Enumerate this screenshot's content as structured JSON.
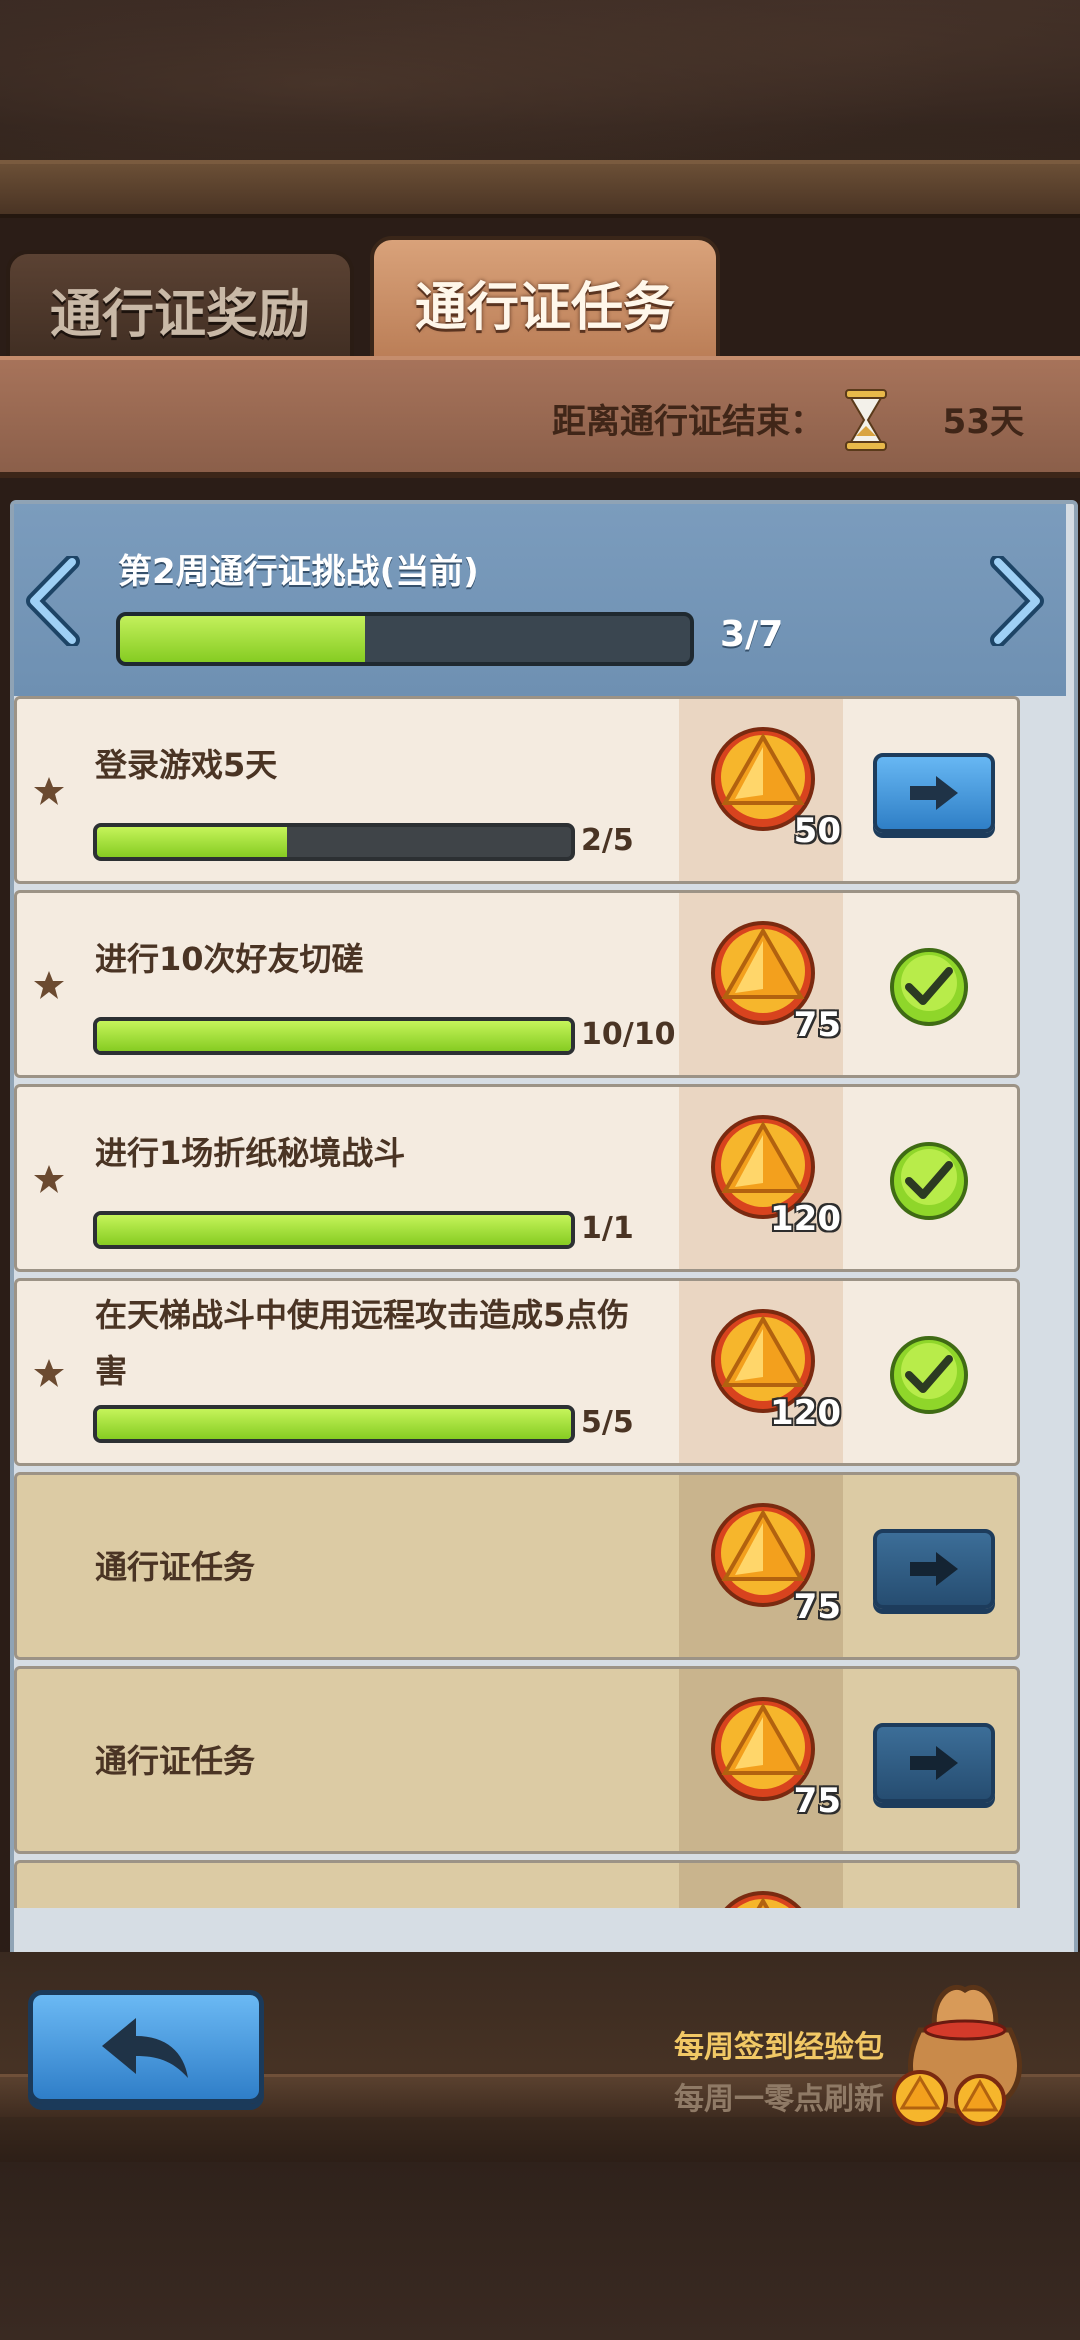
{
  "tabs": [
    {
      "label": "通行证奖励",
      "active": false
    },
    {
      "label": "通行证任务",
      "active": true
    }
  ],
  "countdown": {
    "label": "距离通行证结束：",
    "value": "53天"
  },
  "week": {
    "title": "第2周通行证挑战(当前)",
    "progress_text": "3/7",
    "progress": 0.43
  },
  "tasks": [
    {
      "name": "登录游戏5天",
      "progress_text": "2/5",
      "progress": 0.4,
      "reward": "50",
      "state": "go"
    },
    {
      "name": "进行10次好友切磋",
      "progress_text": "10/10",
      "progress": 1.0,
      "reward": "75",
      "state": "done"
    },
    {
      "name": "进行1场折纸秘境战斗",
      "progress_text": "1/1",
      "progress": 1.0,
      "reward": "120",
      "state": "done"
    },
    {
      "name": "在天梯战斗中使用远程攻击造成5点伤害",
      "progress_text": "5/5",
      "progress": 1.0,
      "reward": "120",
      "state": "done"
    },
    {
      "name": "通行证任务",
      "reward": "75",
      "state": "locked"
    },
    {
      "name": "通行证任务",
      "reward": "75",
      "state": "locked"
    }
  ],
  "weekly_pack": {
    "title": "每周签到经验包",
    "subtitle": "每周一零点刷新"
  },
  "colors": {
    "progress_green": "#86cc22",
    "button_blue": "#2f7fc6",
    "header_blue": "#7b9cbd"
  }
}
